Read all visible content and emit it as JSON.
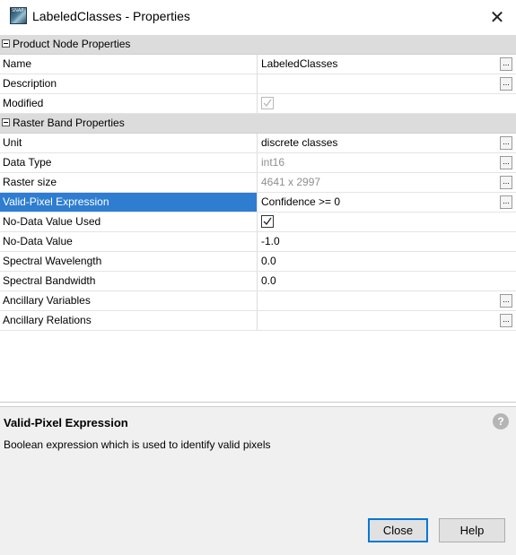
{
  "window": {
    "title": "LabeledClasses - Properties",
    "icon_text": "SNAP",
    "close_glyph": "✕"
  },
  "categories": [
    {
      "label": "Product Node Properties"
    },
    {
      "label": "Raster Band Properties"
    }
  ],
  "rows": {
    "name": {
      "label": "Name",
      "value": "LabeledClasses"
    },
    "description": {
      "label": "Description",
      "value": ""
    },
    "modified": {
      "label": "Modified",
      "checked": true,
      "enabled": false
    },
    "unit": {
      "label": "Unit",
      "value": "discrete classes"
    },
    "data_type": {
      "label": "Data Type",
      "value": "int16"
    },
    "raster_size": {
      "label": "Raster size",
      "value": "4641 x 2997"
    },
    "valid_pixel": {
      "label": "Valid-Pixel Expression",
      "value": "Confidence >= 0"
    },
    "no_data_used": {
      "label": "No-Data Value Used",
      "checked": true,
      "enabled": true
    },
    "no_data_value": {
      "label": "No-Data Value",
      "value": "-1.0"
    },
    "spectral_wavelength": {
      "label": "Spectral Wavelength",
      "value": "0.0"
    },
    "spectral_bandwidth": {
      "label": "Spectral Bandwidth",
      "value": "0.0"
    },
    "ancillary_variables": {
      "label": "Ancillary Variables",
      "value": ""
    },
    "ancillary_relations": {
      "label": "Ancillary Relations",
      "value": ""
    }
  },
  "ellipsis": "...",
  "help": {
    "title": "Valid-Pixel Expression",
    "text": "Boolean expression which is used to identify valid pixels",
    "icon_glyph": "?"
  },
  "buttons": {
    "close": "Close",
    "help": "Help"
  },
  "colors": {
    "selection": "#2e7dd1",
    "category_bg": "#dcdcdc"
  }
}
